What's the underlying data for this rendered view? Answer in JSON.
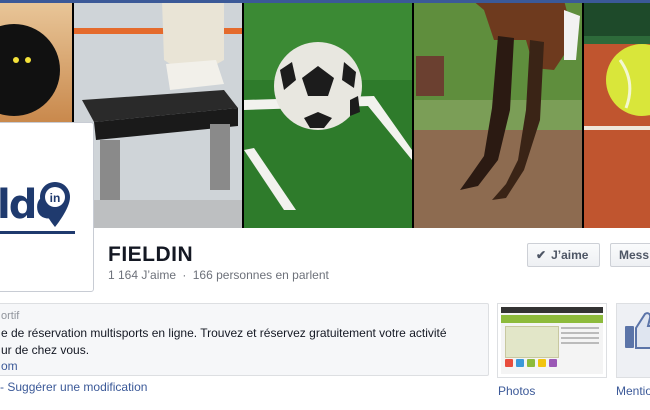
{
  "cover": {
    "panels": [
      "squash-ball",
      "step-platform",
      "soccer-ball",
      "horse-legs",
      "tennis-ball"
    ],
    "accent": "#3b5998"
  },
  "profile": {
    "logo_text": "ldo",
    "logo_pin_text": "in"
  },
  "page": {
    "name": "FIELDIN",
    "likes": "1 164 J’aime",
    "separator": "·",
    "talking": "166 personnes en parlent"
  },
  "actions": {
    "like_check": "✔",
    "like_label": "J’aime",
    "message_label": "Mess"
  },
  "about": {
    "category": "ortif",
    "description_line1": "e de réservation multisports en ligne. Trouvez et réservez gratuitement votre activité",
    "description_line2": "ur de chez vous.",
    "link": "om",
    "suggest_prefix": "-",
    "suggest_label": "Suggérer une modification"
  },
  "tabs": {
    "photos_label": "Photos",
    "mentions_label": "Mentio"
  },
  "colors": {
    "link": "#3b5998",
    "muted": "#6d717a",
    "logo": "#1f3a6e"
  }
}
